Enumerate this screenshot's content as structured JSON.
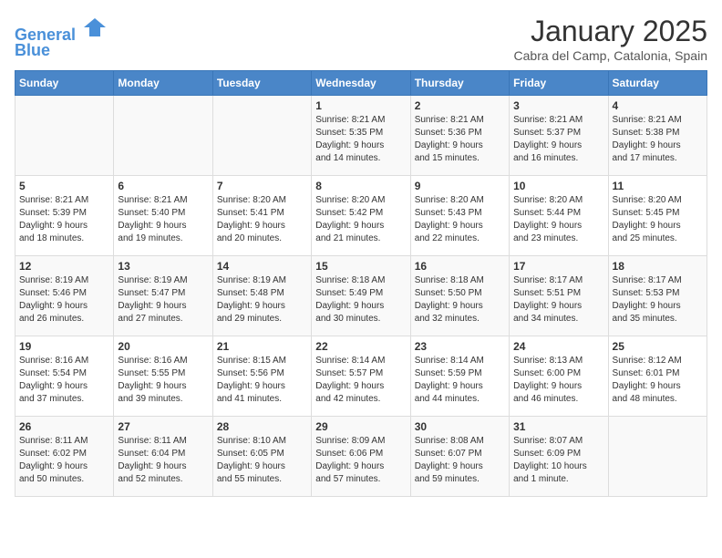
{
  "header": {
    "logo_line1": "General",
    "logo_line2": "Blue",
    "month": "January 2025",
    "location": "Cabra del Camp, Catalonia, Spain"
  },
  "weekdays": [
    "Sunday",
    "Monday",
    "Tuesday",
    "Wednesday",
    "Thursday",
    "Friday",
    "Saturday"
  ],
  "weeks": [
    [
      {
        "day": "",
        "info": ""
      },
      {
        "day": "",
        "info": ""
      },
      {
        "day": "",
        "info": ""
      },
      {
        "day": "1",
        "info": "Sunrise: 8:21 AM\nSunset: 5:35 PM\nDaylight: 9 hours\nand 14 minutes."
      },
      {
        "day": "2",
        "info": "Sunrise: 8:21 AM\nSunset: 5:36 PM\nDaylight: 9 hours\nand 15 minutes."
      },
      {
        "day": "3",
        "info": "Sunrise: 8:21 AM\nSunset: 5:37 PM\nDaylight: 9 hours\nand 16 minutes."
      },
      {
        "day": "4",
        "info": "Sunrise: 8:21 AM\nSunset: 5:38 PM\nDaylight: 9 hours\nand 17 minutes."
      }
    ],
    [
      {
        "day": "5",
        "info": "Sunrise: 8:21 AM\nSunset: 5:39 PM\nDaylight: 9 hours\nand 18 minutes."
      },
      {
        "day": "6",
        "info": "Sunrise: 8:21 AM\nSunset: 5:40 PM\nDaylight: 9 hours\nand 19 minutes."
      },
      {
        "day": "7",
        "info": "Sunrise: 8:20 AM\nSunset: 5:41 PM\nDaylight: 9 hours\nand 20 minutes."
      },
      {
        "day": "8",
        "info": "Sunrise: 8:20 AM\nSunset: 5:42 PM\nDaylight: 9 hours\nand 21 minutes."
      },
      {
        "day": "9",
        "info": "Sunrise: 8:20 AM\nSunset: 5:43 PM\nDaylight: 9 hours\nand 22 minutes."
      },
      {
        "day": "10",
        "info": "Sunrise: 8:20 AM\nSunset: 5:44 PM\nDaylight: 9 hours\nand 23 minutes."
      },
      {
        "day": "11",
        "info": "Sunrise: 8:20 AM\nSunset: 5:45 PM\nDaylight: 9 hours\nand 25 minutes."
      }
    ],
    [
      {
        "day": "12",
        "info": "Sunrise: 8:19 AM\nSunset: 5:46 PM\nDaylight: 9 hours\nand 26 minutes."
      },
      {
        "day": "13",
        "info": "Sunrise: 8:19 AM\nSunset: 5:47 PM\nDaylight: 9 hours\nand 27 minutes."
      },
      {
        "day": "14",
        "info": "Sunrise: 8:19 AM\nSunset: 5:48 PM\nDaylight: 9 hours\nand 29 minutes."
      },
      {
        "day": "15",
        "info": "Sunrise: 8:18 AM\nSunset: 5:49 PM\nDaylight: 9 hours\nand 30 minutes."
      },
      {
        "day": "16",
        "info": "Sunrise: 8:18 AM\nSunset: 5:50 PM\nDaylight: 9 hours\nand 32 minutes."
      },
      {
        "day": "17",
        "info": "Sunrise: 8:17 AM\nSunset: 5:51 PM\nDaylight: 9 hours\nand 34 minutes."
      },
      {
        "day": "18",
        "info": "Sunrise: 8:17 AM\nSunset: 5:53 PM\nDaylight: 9 hours\nand 35 minutes."
      }
    ],
    [
      {
        "day": "19",
        "info": "Sunrise: 8:16 AM\nSunset: 5:54 PM\nDaylight: 9 hours\nand 37 minutes."
      },
      {
        "day": "20",
        "info": "Sunrise: 8:16 AM\nSunset: 5:55 PM\nDaylight: 9 hours\nand 39 minutes."
      },
      {
        "day": "21",
        "info": "Sunrise: 8:15 AM\nSunset: 5:56 PM\nDaylight: 9 hours\nand 41 minutes."
      },
      {
        "day": "22",
        "info": "Sunrise: 8:14 AM\nSunset: 5:57 PM\nDaylight: 9 hours\nand 42 minutes."
      },
      {
        "day": "23",
        "info": "Sunrise: 8:14 AM\nSunset: 5:59 PM\nDaylight: 9 hours\nand 44 minutes."
      },
      {
        "day": "24",
        "info": "Sunrise: 8:13 AM\nSunset: 6:00 PM\nDaylight: 9 hours\nand 46 minutes."
      },
      {
        "day": "25",
        "info": "Sunrise: 8:12 AM\nSunset: 6:01 PM\nDaylight: 9 hours\nand 48 minutes."
      }
    ],
    [
      {
        "day": "26",
        "info": "Sunrise: 8:11 AM\nSunset: 6:02 PM\nDaylight: 9 hours\nand 50 minutes."
      },
      {
        "day": "27",
        "info": "Sunrise: 8:11 AM\nSunset: 6:04 PM\nDaylight: 9 hours\nand 52 minutes."
      },
      {
        "day": "28",
        "info": "Sunrise: 8:10 AM\nSunset: 6:05 PM\nDaylight: 9 hours\nand 55 minutes."
      },
      {
        "day": "29",
        "info": "Sunrise: 8:09 AM\nSunset: 6:06 PM\nDaylight: 9 hours\nand 57 minutes."
      },
      {
        "day": "30",
        "info": "Sunrise: 8:08 AM\nSunset: 6:07 PM\nDaylight: 9 hours\nand 59 minutes."
      },
      {
        "day": "31",
        "info": "Sunrise: 8:07 AM\nSunset: 6:09 PM\nDaylight: 10 hours\nand 1 minute."
      },
      {
        "day": "",
        "info": ""
      }
    ]
  ]
}
